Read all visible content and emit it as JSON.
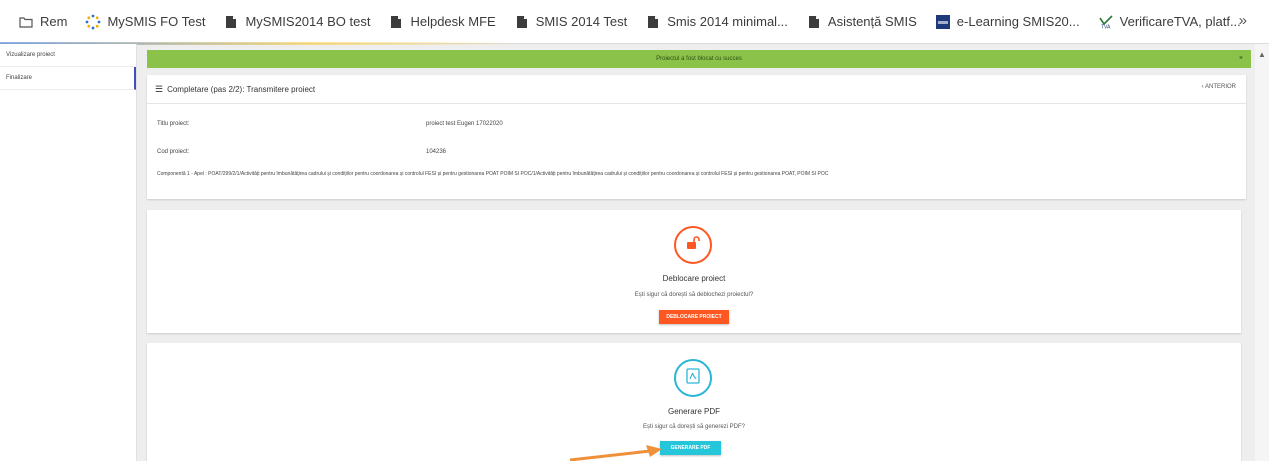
{
  "bookmarks": [
    {
      "label": "Rem",
      "icon": "folder-icon"
    },
    {
      "label": "MySMIS FO Test",
      "icon": "spinner-icon"
    },
    {
      "label": "MySMIS2014 BO test",
      "icon": "doc-icon"
    },
    {
      "label": "Helpdesk MFE",
      "icon": "doc-icon"
    },
    {
      "label": "SMIS 2014 Test",
      "icon": "doc-icon"
    },
    {
      "label": "Smis 2014  minimal...",
      "icon": "doc-icon"
    },
    {
      "label": "Asistență SMIS",
      "icon": "doc-icon"
    },
    {
      "label": "e-Learning SMIS20...",
      "icon": "elearning-icon"
    },
    {
      "label": "VerificareTVA, platf...",
      "icon": "tva-icon"
    }
  ],
  "bookmarks_more": "»",
  "sidebar": {
    "items": [
      {
        "label": "Vizualizare proiect"
      },
      {
        "label": "Finalizare"
      }
    ]
  },
  "success_message": "Proiectul a fost blocat cu succes",
  "success_close": "×",
  "card1": {
    "title": "Completare (pas 2/2): Transmitere proiect",
    "back": "‹ ANTERIOR",
    "titlu_label": "Titlu proiect:",
    "titlu_value": "proiect test Eugen 17022020",
    "cod_label": "Cod proiect:",
    "cod_value": "104236",
    "componenta": "Componentă 1 - Apel : POAT/299/2/1/Activități pentru îmbunătățirea cadrului și condițiilor pentru coordonarea și controlul FESI și pentru gestionarea POAT POIM SI POC/1/Activități pentru îmbunătățirea cadrului și condițiilor pentru coordonarea și controlul FESI și pentru gestionarea POAT, POIM SI POC"
  },
  "deblocare": {
    "title": "Deblocare proiect",
    "question": "Ești sigur că dorești să deblochezi proiectul?",
    "button": "DEBLOCARE PROIECT"
  },
  "pdf": {
    "title": "Generare PDF",
    "question": "Ești sigur că dorești să generezi PDF?",
    "button": "GENERARE PDF"
  },
  "colors": {
    "success": "#8bc34a",
    "orange": "#ff5722",
    "cyan": "#26c6da",
    "arrow": "#f0903a"
  }
}
